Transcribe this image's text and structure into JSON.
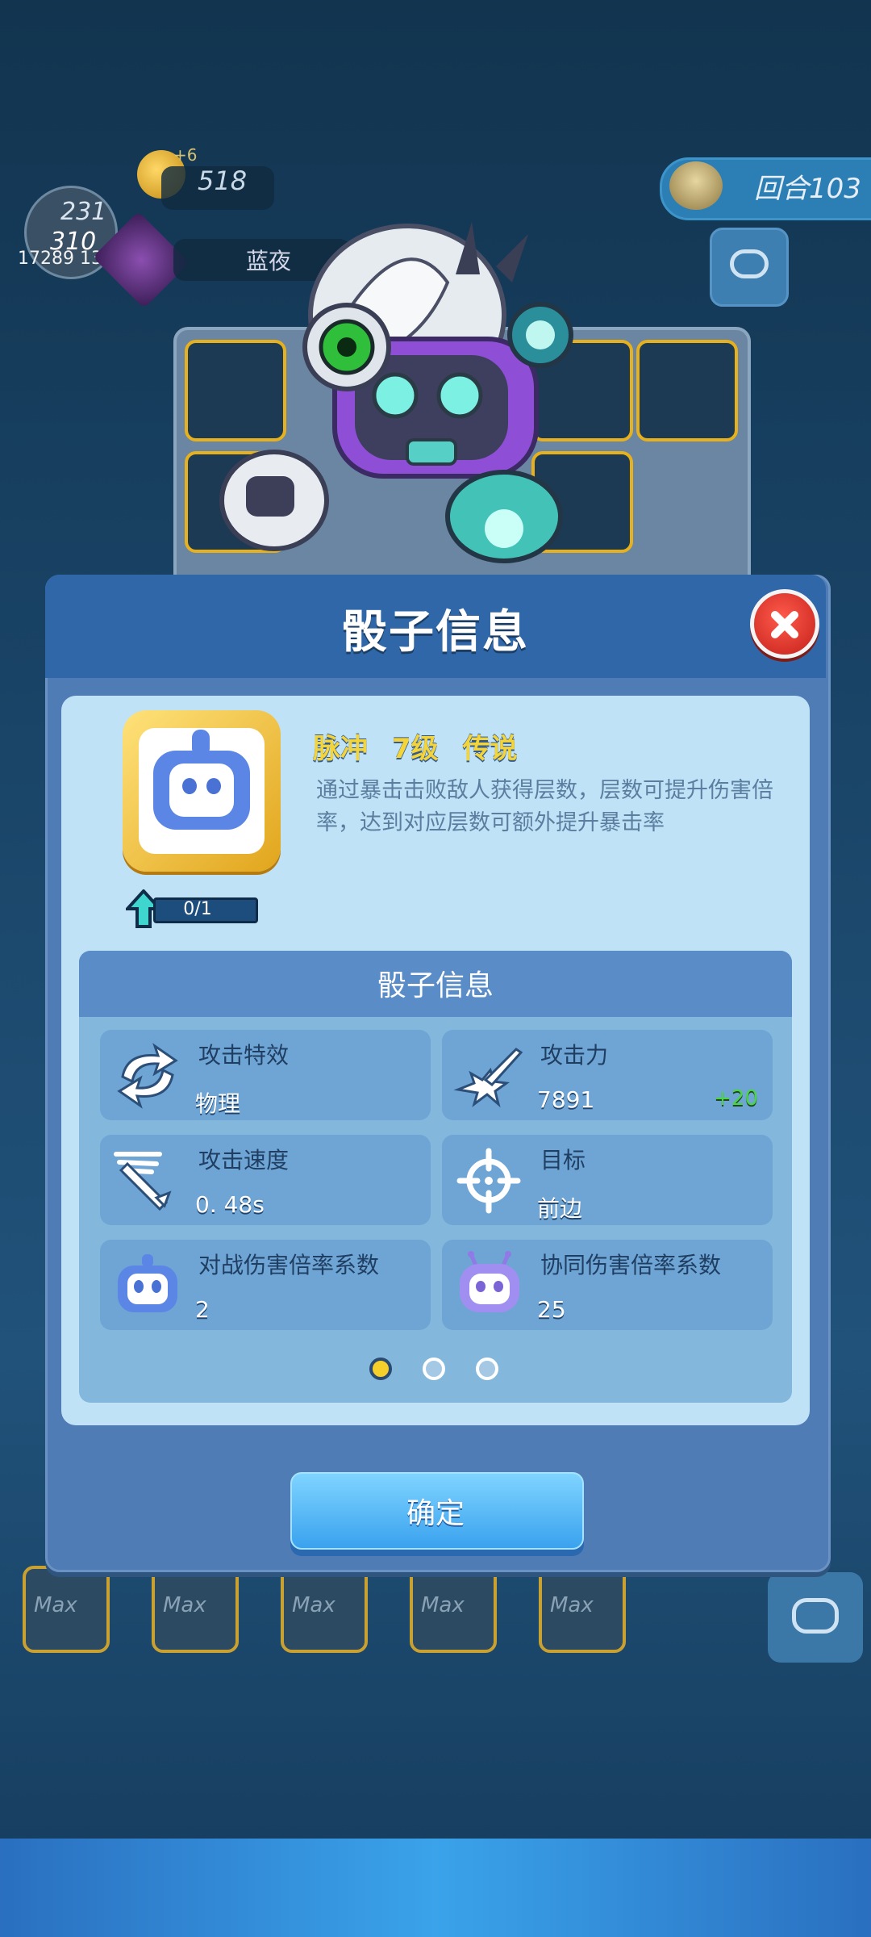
{
  "hud": {
    "key_count": "518",
    "key_bonus": "+6",
    "round_label": "回合103",
    "avatar_num1": "231",
    "avatar_num2": "310",
    "player_id": "17289  130",
    "player_name": "蓝夜"
  },
  "dialog": {
    "title": "骰子信息",
    "dice": {
      "name": "脉冲",
      "level": "7级",
      "rarity": "传说",
      "description": "通过暴击击败敌人获得层数，层数可提升伤害倍率，达到对应层数可额外提升暴击率",
      "progress": "0/1",
      "progress_fraction": 0
    },
    "info_title": "骰子信息",
    "stats": [
      {
        "label": "攻击特效",
        "value": "物理",
        "bonus": "",
        "icon": "swap-arrows-icon"
      },
      {
        "label": "攻击力",
        "value": "7891",
        "bonus": "+20",
        "icon": "sword-burst-icon"
      },
      {
        "label": "攻击速度",
        "value": "0. 48s",
        "bonus": "",
        "icon": "fast-sword-icon"
      },
      {
        "label": "目标",
        "value": "前边",
        "bonus": "",
        "icon": "crosshair-icon"
      },
      {
        "label": "对战伤害倍率系数",
        "value": "2",
        "bonus": "",
        "icon": "robot-blue-icon"
      },
      {
        "label": "协同伤害倍率系数",
        "value": "25",
        "bonus": "",
        "icon": "robot-purple-icon"
      }
    ],
    "pagination": {
      "total": 3,
      "active": 0
    },
    "confirm_label": "确定"
  },
  "colors": {
    "dialog_header": "#2f67a8",
    "panel": "#bfe2f6",
    "accent_gold": "#f3d43a",
    "bonus_green": "#4ed24e"
  }
}
